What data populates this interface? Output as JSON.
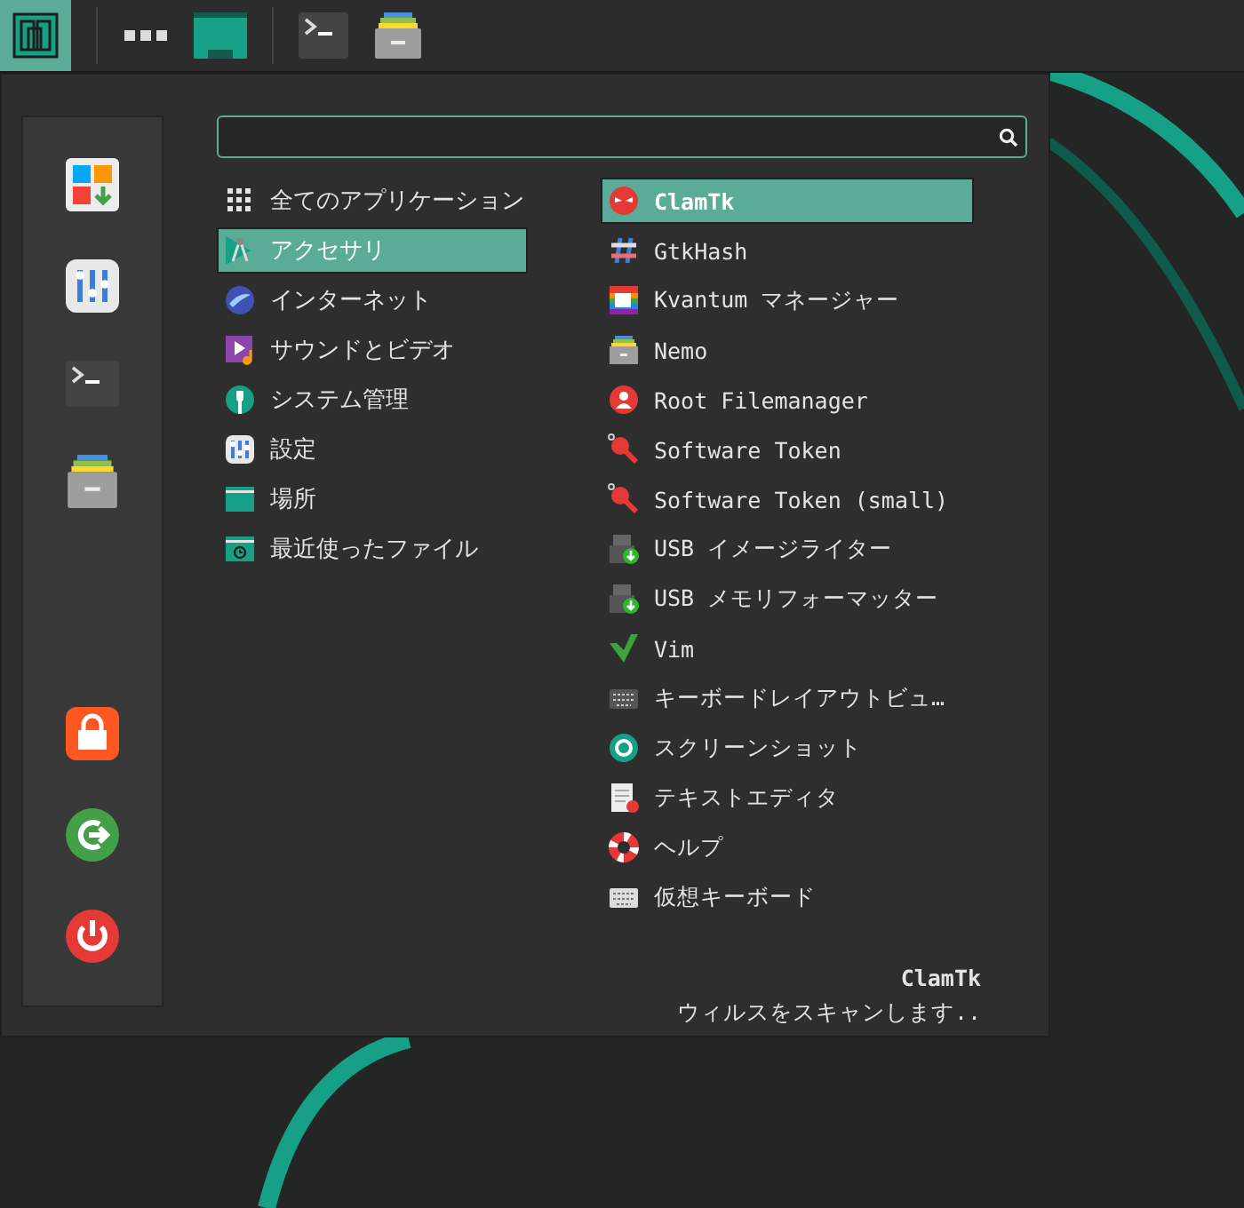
{
  "menu_button": {
    "active": true
  },
  "categories": [
    {
      "label": "全てのアプリケーション",
      "selected": false
    },
    {
      "label": "アクセサリ",
      "selected": true
    },
    {
      "label": "インターネット",
      "selected": false
    },
    {
      "label": "サウンドとビデオ",
      "selected": false
    },
    {
      "label": "システム管理",
      "selected": false
    },
    {
      "label": "設定",
      "selected": false
    },
    {
      "label": "場所",
      "selected": false
    },
    {
      "label": "最近使ったファイル",
      "selected": false
    }
  ],
  "apps": [
    {
      "label": "ClamTk",
      "selected": true
    },
    {
      "label": "GtkHash",
      "selected": false
    },
    {
      "label": "Kvantum マネージャー",
      "selected": false
    },
    {
      "label": "Nemo",
      "selected": false
    },
    {
      "label": "Root Filemanager",
      "selected": false
    },
    {
      "label": "Software Token",
      "selected": false
    },
    {
      "label": "Software Token (small)",
      "selected": false
    },
    {
      "label": "USB イメージライター",
      "selected": false
    },
    {
      "label": "USB メモリフォーマッター",
      "selected": false
    },
    {
      "label": "Vim",
      "selected": false
    },
    {
      "label": "キーボードレイアウトビュ…",
      "selected": false
    },
    {
      "label": "スクリーンショット",
      "selected": false
    },
    {
      "label": "テキストエディタ",
      "selected": false
    },
    {
      "label": "ヘルプ",
      "selected": false
    },
    {
      "label": "仮想キーボード",
      "selected": false
    }
  ],
  "details": {
    "title": "ClamTk",
    "description": "ウィルスをスキャンします.."
  }
}
